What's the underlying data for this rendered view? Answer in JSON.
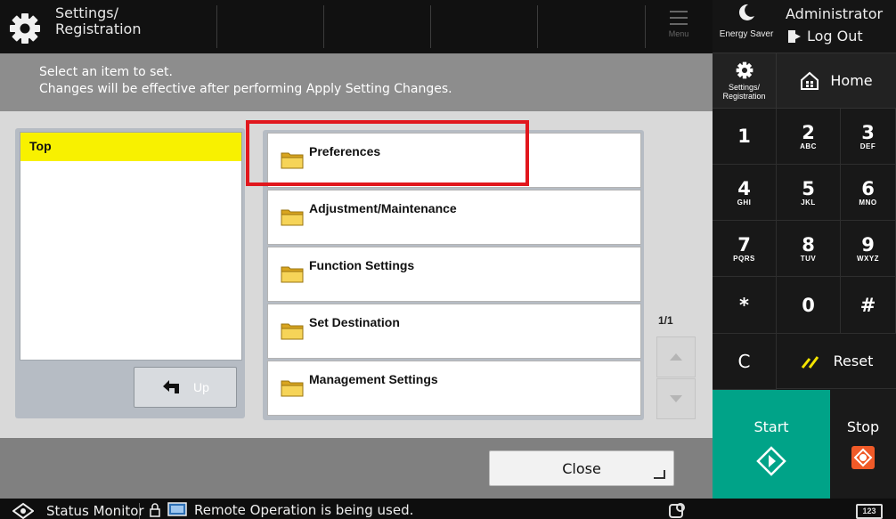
{
  "topbar": {
    "title": "Settings/\nRegistration",
    "menu_label": "Menu",
    "energy_saver": "Energy Saver",
    "user": "Administrator",
    "logout": "Log Out"
  },
  "instruction": {
    "text": "Select an item to set.\nChanges will be effective after performing Apply Setting Changes."
  },
  "tree": {
    "top_label": "Top",
    "up_label": "Up"
  },
  "list": {
    "items": [
      {
        "label": "Preferences"
      },
      {
        "label": "Adjustment/Maintenance"
      },
      {
        "label": "Function Settings"
      },
      {
        "label": "Set Destination"
      },
      {
        "label": "Management Settings"
      }
    ],
    "page_indicator": "1/1"
  },
  "close_label": "Close",
  "statusbar": {
    "status_monitor": "Status Monitor",
    "remote": "Remote Operation is being used."
  },
  "keypad": {
    "settings_label": "Settings/\nRegistration",
    "home_label": "Home",
    "keys": [
      {
        "num": "1",
        "sub": ""
      },
      {
        "num": "2",
        "sub": "ABC"
      },
      {
        "num": "3",
        "sub": "DEF"
      },
      {
        "num": "4",
        "sub": "GHI"
      },
      {
        "num": "5",
        "sub": "JKL"
      },
      {
        "num": "6",
        "sub": "MNO"
      },
      {
        "num": "7",
        "sub": "PQRS"
      },
      {
        "num": "8",
        "sub": "TUV"
      },
      {
        "num": "9",
        "sub": "WXYZ"
      },
      {
        "num": "*",
        "sub": ""
      },
      {
        "num": "0",
        "sub": ""
      },
      {
        "num": "#",
        "sub": ""
      }
    ],
    "clear_label": "C",
    "reset_label": "Reset",
    "start_label": "Start",
    "stop_label": "Stop",
    "kbd_label": "123"
  },
  "colors": {
    "highlight": "#e1171d",
    "tree_selected": "#f8f100",
    "start": "#00a388",
    "stop": "#f05a28",
    "reset_slash": "#f4e400"
  }
}
